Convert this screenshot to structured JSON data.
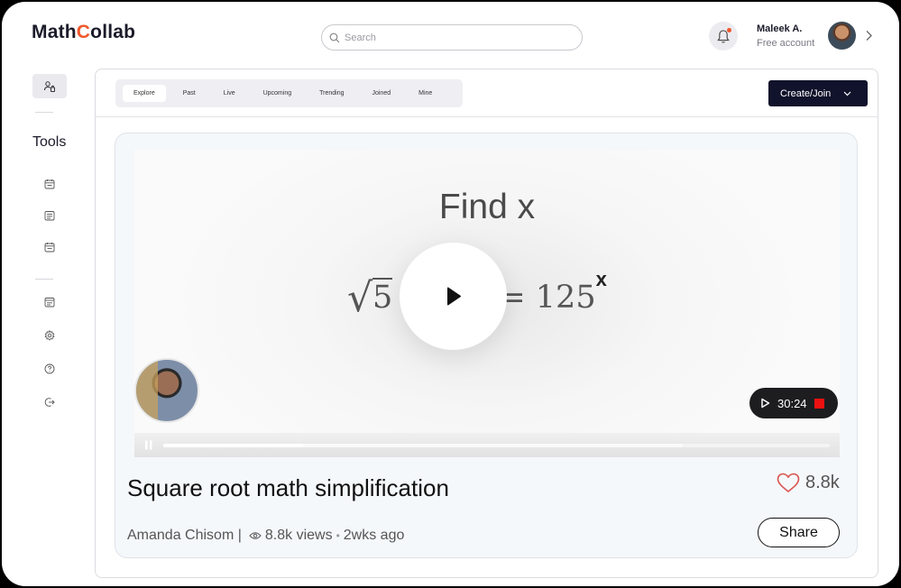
{
  "header": {
    "logo_prefix": "Math",
    "logo_accent": "C",
    "logo_suffix": "ollab",
    "search_placeholder": "Search",
    "user_name": "Maleek A.",
    "user_plan": "Free account"
  },
  "sidebar": {
    "section_title": "Tools",
    "icons": [
      "calendar-icon",
      "note-icon",
      "calendar-icon",
      "note-icon",
      "gear-icon",
      "help-icon",
      "logout-icon"
    ]
  },
  "tabs": [
    {
      "label": "Explore",
      "active": true
    },
    {
      "label": "Past",
      "active": false
    },
    {
      "label": "Live",
      "active": false
    },
    {
      "label": "Upcoming",
      "active": false
    },
    {
      "label": "Trending",
      "active": false
    },
    {
      "label": "Joined",
      "active": false
    },
    {
      "label": "Mine",
      "active": false
    }
  ],
  "create_button_label": "Create/Join",
  "video": {
    "slide_title": "Find x",
    "equation_visible_left": "5",
    "equation_right": "= 125",
    "equation_exponent": "x",
    "duration": "30:24",
    "progress_fraction": 0.21,
    "buffer_fraction": 0.78,
    "title": "Square root math simplification",
    "likes": "8.8k",
    "author": "Amanda Chisom |",
    "views": "8.8k views",
    "age": "2wks ago",
    "share_label": "Share"
  },
  "colors": {
    "accent": "#f0572a",
    "primary_button": "#11122b",
    "record": "#e11111",
    "heart": "#d9534f"
  }
}
